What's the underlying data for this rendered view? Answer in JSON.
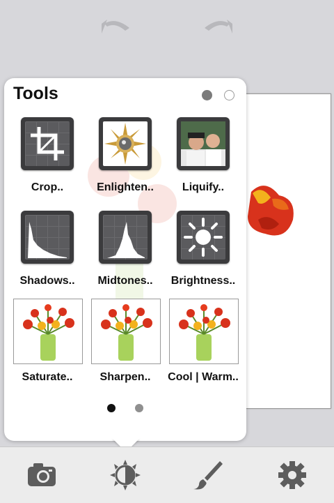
{
  "popover": {
    "title": "Tools",
    "tools": [
      {
        "label": "Crop..",
        "icon": "crop-icon"
      },
      {
        "label": "Enlighten..",
        "icon": "sun-emblem-icon"
      },
      {
        "label": "Liquify..",
        "icon": "photo-icon"
      },
      {
        "label": "Shadows..",
        "icon": "histogram-shadows-icon"
      },
      {
        "label": "Midtones..",
        "icon": "histogram-midtones-icon"
      },
      {
        "label": "Brightness..",
        "icon": "brightness-icon"
      },
      {
        "label": "Saturate..",
        "icon": "flowers-thumbnail"
      },
      {
        "label": "Sharpen..",
        "icon": "flowers-thumbnail"
      },
      {
        "label": "Cool | Warm..",
        "icon": "flowers-thumbnail"
      }
    ],
    "page_indicator": {
      "current": 1,
      "total": 2
    }
  },
  "toolbar": {
    "items": [
      {
        "icon": "camera-icon"
      },
      {
        "icon": "adjust-icon",
        "selected": true
      },
      {
        "icon": "brush-icon"
      },
      {
        "icon": "gear-icon"
      }
    ]
  },
  "history": {
    "undo_icon": "undo-arrow-icon",
    "redo_icon": "redo-arrow-icon"
  },
  "colors": {
    "popover_bg": "#ffffff",
    "tile_bg": "#3b3b3d",
    "flower_red": "#d8321c",
    "flower_yellow": "#f3b21d"
  }
}
